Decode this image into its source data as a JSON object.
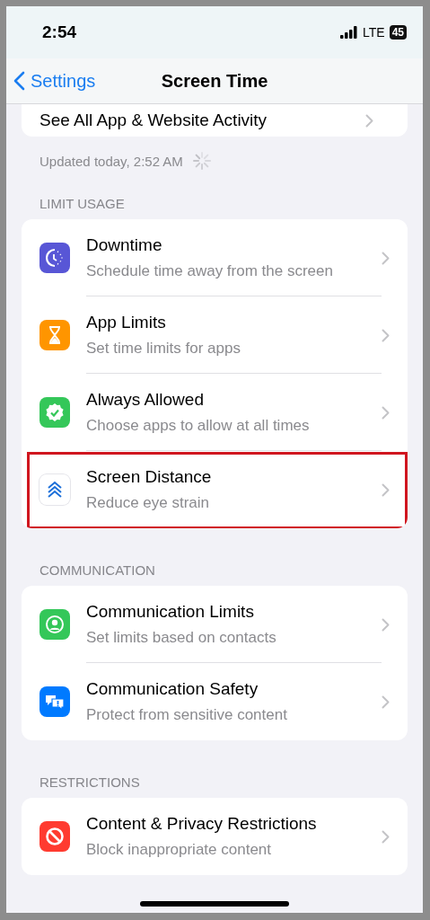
{
  "status_bar": {
    "time": "2:54",
    "network": "LTE",
    "battery": "45"
  },
  "nav": {
    "back": "Settings",
    "title": "Screen Time"
  },
  "activity_row": {
    "label": "See All App & Website Activity"
  },
  "updated": {
    "text": "Updated today, 2:52 AM",
    "loading": true
  },
  "sections": [
    {
      "header": "LIMIT USAGE",
      "items": [
        {
          "kind": "downtime",
          "color": "#5856d6",
          "title": "Downtime",
          "subtitle": "Schedule time away from the screen",
          "highlighted": false
        },
        {
          "kind": "hourglass",
          "color": "#ff9500",
          "title": "App Limits",
          "subtitle": "Set time limits for apps",
          "highlighted": false
        },
        {
          "kind": "check",
          "color": "#34c759",
          "title": "Always Allowed",
          "subtitle": "Choose apps to allow at all times",
          "highlighted": false
        },
        {
          "kind": "distance",
          "color": "#ffffff",
          "title": "Screen Distance",
          "subtitle": "Reduce eye strain",
          "highlighted": true
        }
      ]
    },
    {
      "header": "COMMUNICATION",
      "items": [
        {
          "kind": "person",
          "color": "#34c759",
          "title": "Communication Limits",
          "subtitle": "Set limits based on contacts",
          "highlighted": false
        },
        {
          "kind": "bubbles",
          "color": "#007aff",
          "title": "Communication Safety",
          "subtitle": "Protect from sensitive content",
          "highlighted": false
        }
      ]
    },
    {
      "header": "RESTRICTIONS",
      "items": [
        {
          "kind": "block",
          "color": "#ff3b30",
          "title": "Content & Privacy Restrictions",
          "subtitle": "Block inappropriate content",
          "highlighted": false
        }
      ]
    }
  ]
}
